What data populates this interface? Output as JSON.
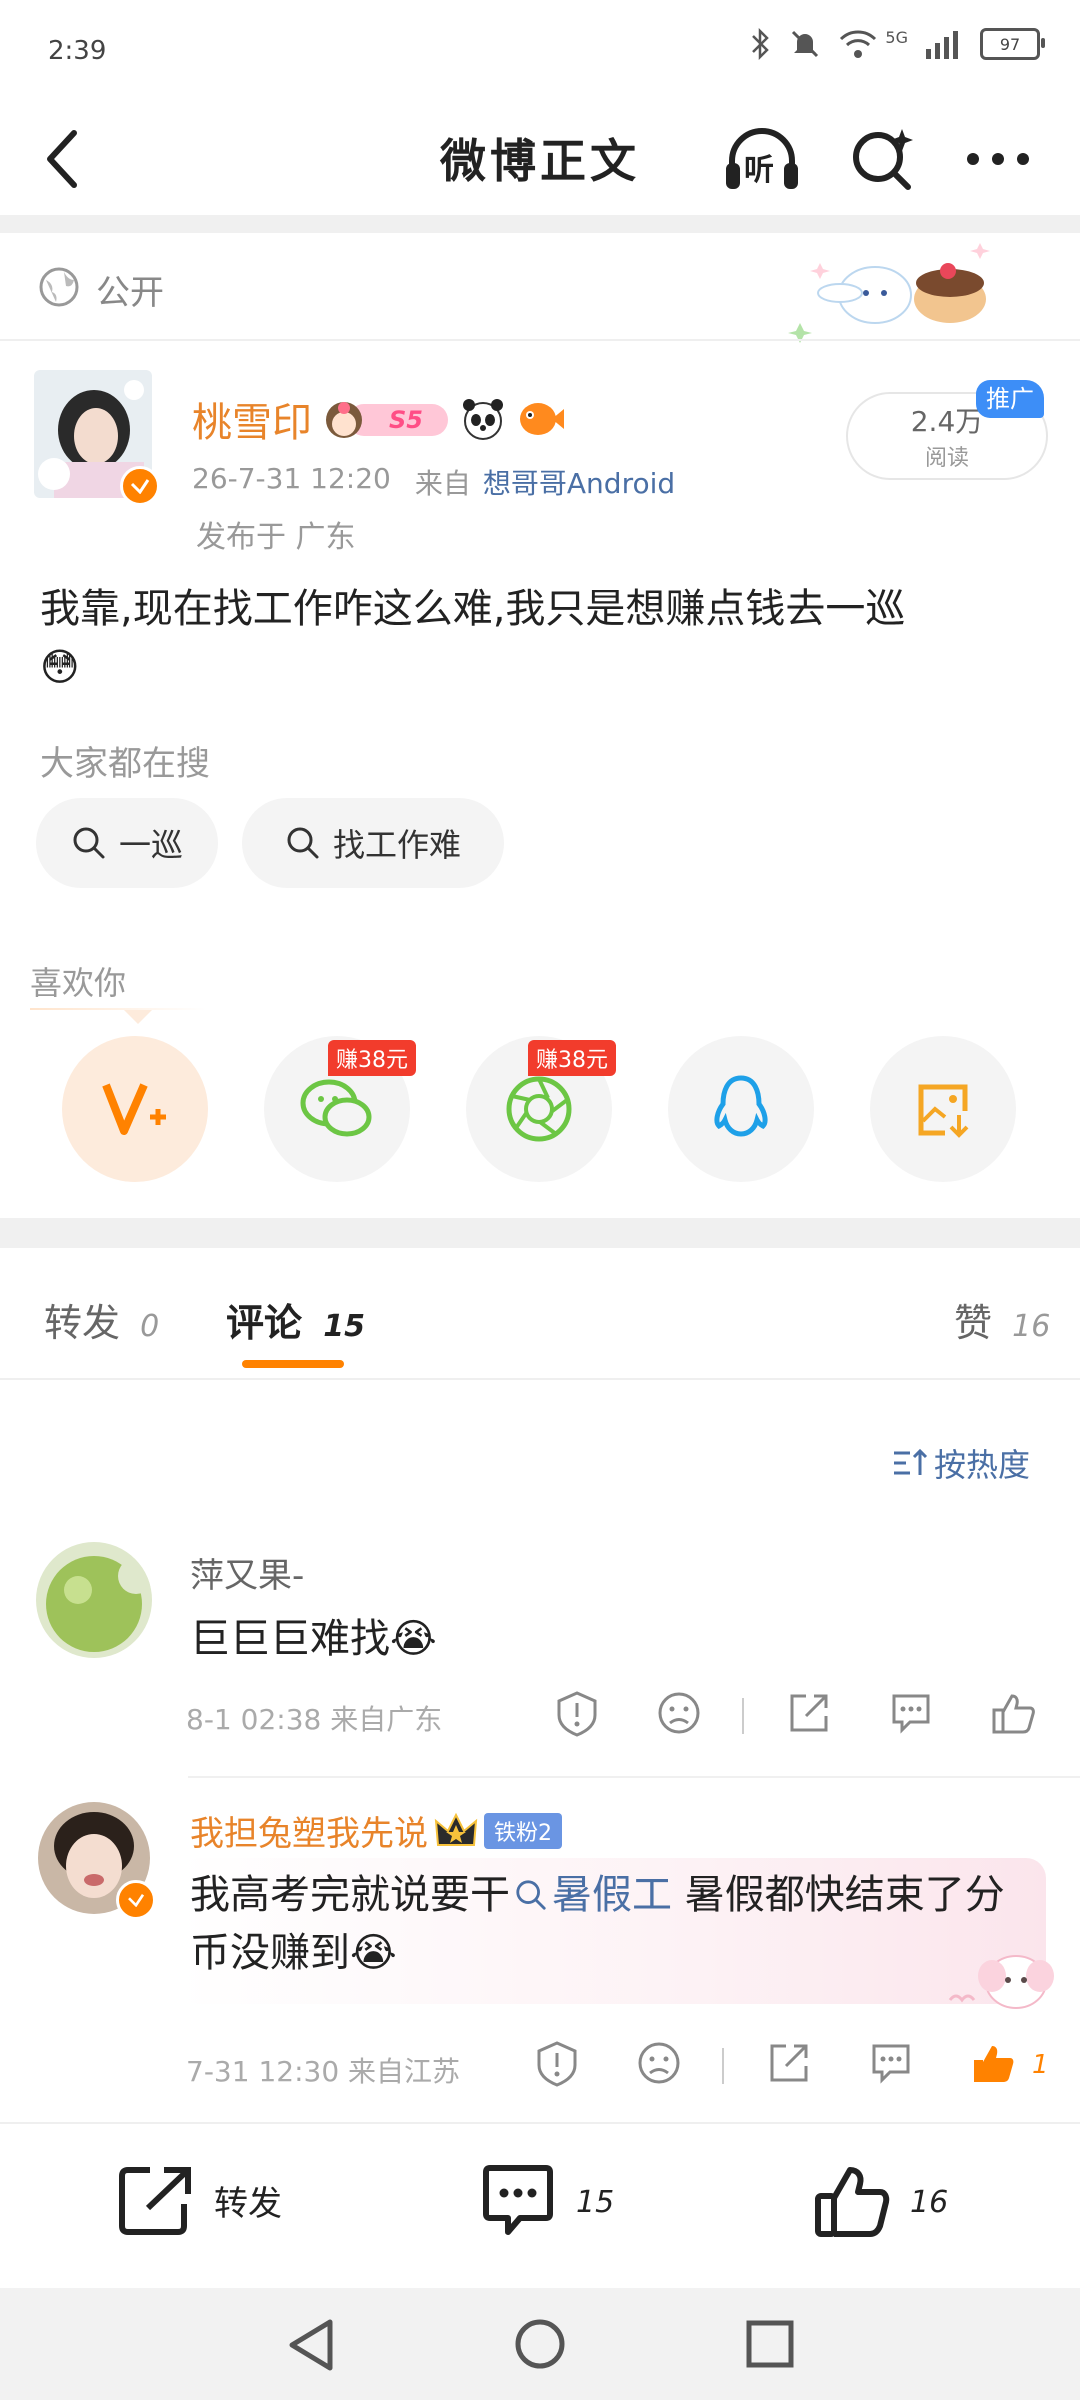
{
  "status_bar": {
    "time": "2:39",
    "network": "5G",
    "battery": "97"
  },
  "header": {
    "title": "微博正文",
    "listen_label": "听"
  },
  "visibility": {
    "label": "公开"
  },
  "post": {
    "author": "桃雪印",
    "level_badge": "S5",
    "timestamp": "26-7-31 12:20",
    "source_prefix": "来自",
    "source_device": "想哥哥Android",
    "location": "发布于 广东",
    "promo_badge": "推广",
    "read_count": "2.4万",
    "read_label": "阅读",
    "text": "我靠,现在找工作咋这么难,我只是想赚点钱去一巡",
    "emoji": "😳"
  },
  "search_section": {
    "title": "大家都在搜",
    "chips": [
      "一巡",
      "找工作难"
    ]
  },
  "share_section": {
    "title": "喜欢你",
    "earn_badges": [
      "赚38元",
      "赚38元"
    ]
  },
  "tabs": {
    "repost_label": "转发",
    "repost_count": "0",
    "comment_label": "评论",
    "comment_count": "15",
    "like_label": "赞",
    "like_count": "16"
  },
  "sort": {
    "label": "按热度"
  },
  "comments": [
    {
      "name": "萍又果-",
      "text": "巨巨巨难找",
      "emoji": "😭",
      "meta": "8-1 02:38 来自广东",
      "likes": ""
    },
    {
      "name": "我担兔塑我先说",
      "fan_badge": "铁粉2",
      "text_before": "我高考完就说要干",
      "topic": "暑假工",
      "text_after": " 暑假都快结束了分币没赚到",
      "emoji": "😭",
      "meta": "7-31 12:30 来自江苏",
      "likes": "1"
    }
  ],
  "bottom_bar": {
    "repost_label": "转发",
    "comment_count": "15",
    "like_count": "16"
  },
  "colors": {
    "accent": "#ff8200",
    "link": "#4a6fa5",
    "earn": "#f23c2c",
    "orange_name": "#e8842a"
  }
}
